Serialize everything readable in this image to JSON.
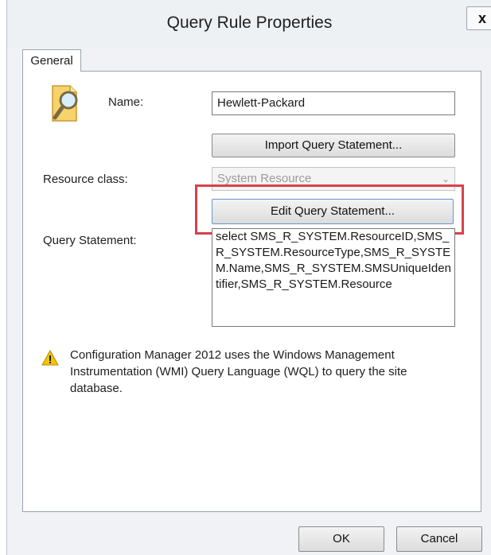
{
  "window": {
    "title": "Query Rule Properties",
    "close_glyph": "x"
  },
  "tabs": [
    {
      "label": "General",
      "selected": true
    }
  ],
  "form": {
    "icon": "query-magnifier-icon",
    "name_label": "Name:",
    "name_value": "Hewlett-Packard",
    "import_button": "Import Query Statement...",
    "resource_class_label": "Resource class:",
    "resource_class_value": "System Resource",
    "edit_button": "Edit Query Statement...",
    "query_statement_label": "Query Statement:",
    "query_statement_value": "select SMS_R_SYSTEM.ResourceID,SMS_R_SYSTEM.ResourceType,SMS_R_SYSTEM.Name,SMS_R_SYSTEM.SMSUniqueIdentifier,SMS_R_SYSTEM.Resource",
    "warning_icon": "warning-triangle-icon",
    "warning_text": "Configuration Manager 2012 uses the Windows Management Instrumentation (WMI) Query Language (WQL) to query the site database."
  },
  "footer": {
    "ok_label": "OK",
    "cancel_label": "Cancel"
  },
  "colors": {
    "highlight_border": "#d9414b",
    "warning_yellow": "#f5c400"
  }
}
